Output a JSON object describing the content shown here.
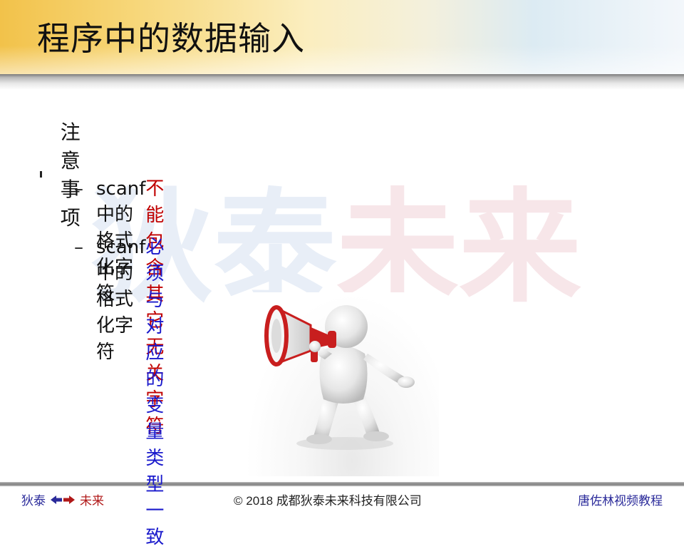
{
  "slide": {
    "title": "程序中的数据输入",
    "bullet": "注意事项",
    "sub_items": [
      {
        "prefix": "scanf 中的格式化字符",
        "highlight": "不能包含其它无关字符",
        "highlight_color": "#c00000"
      },
      {
        "prefix": "scanf 中的格式化字符",
        "highlight": "必须与对应的变量类型一致",
        "highlight_color": "#1a1acc"
      }
    ]
  },
  "watermark": {
    "part_a": "狄泰",
    "part_b": "未来"
  },
  "illustration": {
    "icon": "person-with-megaphone-icon"
  },
  "footer": {
    "left_a": "狄泰",
    "left_b": "未来",
    "arrows_icon": "double-arrow-icon",
    "center": "© 2018 成都狄泰未来科技有限公司",
    "right": "唐佐林视频教程"
  }
}
